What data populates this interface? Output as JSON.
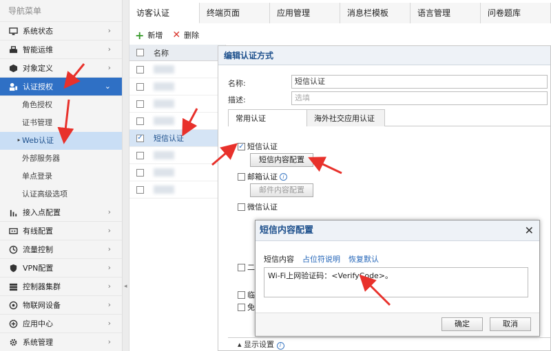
{
  "sidebar": {
    "title": "导航菜单",
    "items": [
      {
        "label": "系统状态",
        "icon": "monitor-icon"
      },
      {
        "label": "智能运维",
        "icon": "tools-icon"
      },
      {
        "label": "对象定义",
        "icon": "cube-icon"
      },
      {
        "label": "认证授权",
        "icon": "user-key-icon",
        "active": true
      },
      {
        "label": "接入点配置",
        "icon": "antenna-icon"
      },
      {
        "label": "有线配置",
        "icon": "wired-icon"
      },
      {
        "label": "流量控制",
        "icon": "flow-icon"
      },
      {
        "label": "VPN配置",
        "icon": "vpn-icon"
      },
      {
        "label": "控制器集群",
        "icon": "cluster-icon"
      },
      {
        "label": "物联网设备",
        "icon": "iot-icon"
      },
      {
        "label": "应用中心",
        "icon": "app-center-icon"
      },
      {
        "label": "系统管理",
        "icon": "gear-icon"
      }
    ],
    "subitems": [
      "角色授权",
      "证书管理",
      "Web认证",
      "外部服务器",
      "单点登录",
      "认证高级选项"
    ]
  },
  "tabs": [
    "访客认证",
    "终端页面",
    "应用管理",
    "消息栏模板",
    "语言管理",
    "问卷题库"
  ],
  "toolbar": {
    "add": "新增",
    "delete": "删除"
  },
  "table": {
    "header": "名称",
    "selected_row": "短信认证"
  },
  "panel": {
    "title": "编辑认证方式",
    "name_label": "名称:",
    "name_value": "短信认证",
    "desc_label": "描述:",
    "desc_placeholder": "选填",
    "subtab_common": "常用认证",
    "subtab_social": "海外社交应用认证",
    "sms_auth": "短信认证",
    "sms_config_btn": "短信内容配置",
    "email_auth": "邮箱认证",
    "email_config_btn": "邮件内容配置",
    "wechat_auth": "微信认证",
    "two_prefix": "二",
    "temp_prefix": "临",
    "free_prefix": "免",
    "display_settings": "显示设置"
  },
  "modal": {
    "title": "短信内容配置",
    "tab_content": "短信内容",
    "link_placeholder": "占位符说明",
    "link_restore": "恢复默认",
    "content": "Wi-Fi上网验证码：<VerifyCode>。",
    "ok": "确定",
    "cancel": "取消"
  },
  "colors": {
    "accent": "#2f70c5",
    "arrow": "#e8312b",
    "title_text": "#1c4f8c"
  }
}
